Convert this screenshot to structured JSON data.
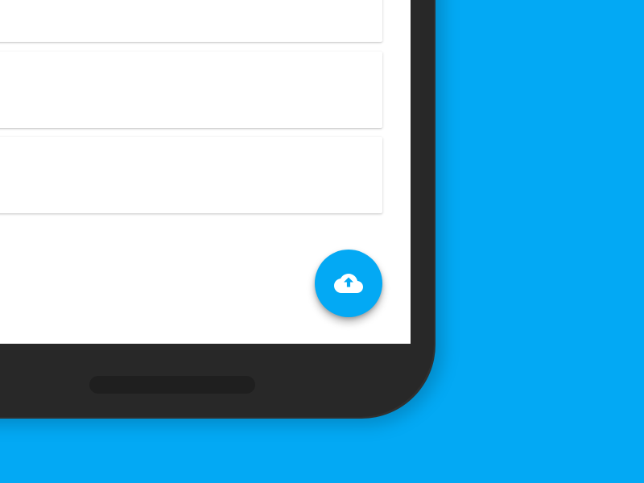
{
  "icons": {
    "fab": "cloud-upload-icon"
  },
  "colors": {
    "background": "#03a9f4",
    "device": "#282828",
    "screen": "#ffffff",
    "accent": "#03a9f4"
  },
  "cards": [
    {
      "id": "card-1"
    },
    {
      "id": "card-2"
    },
    {
      "id": "card-3"
    }
  ]
}
